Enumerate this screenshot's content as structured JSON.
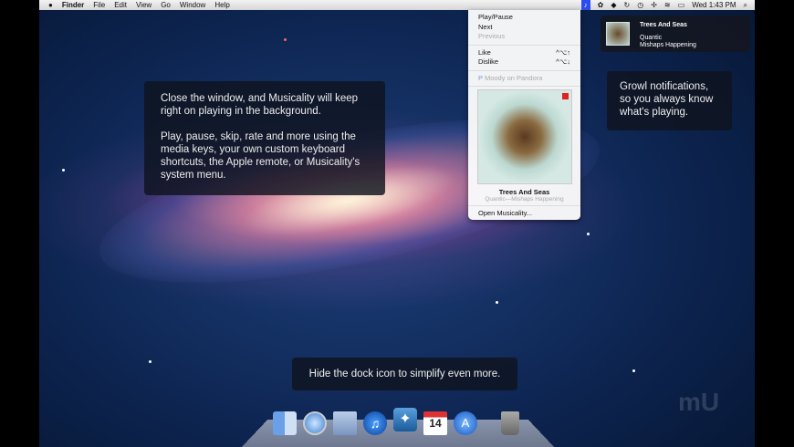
{
  "menubar": {
    "apple": "",
    "items": [
      "Finder",
      "File",
      "Edit",
      "View",
      "Go",
      "Window",
      "Help"
    ],
    "clock": "Wed 1:43 PM"
  },
  "menu": {
    "play": "Play/Pause",
    "next": "Next",
    "previous": "Previous",
    "like": "Like",
    "like_sc": "^⌥↑",
    "dislike": "Dislike",
    "dislike_sc": "^⌥↓",
    "station": "Moody on Pandora",
    "station_icon": "P",
    "track": "Trees And Seas",
    "sub": "Quantic—Mishaps Happening",
    "open": "Open Musicality..."
  },
  "growl": {
    "title": "Trees And Seas",
    "artist": "Quantic",
    "album": "Mishaps Happening"
  },
  "callouts": {
    "main_p1": "Close the window, and Musicality will keep right on playing in the background.",
    "main_p2": "Play, pause, skip, rate and more using the media keys, your own custom keyboard shortcuts, the Apple remote, or Musicality's system menu.",
    "growl": "Growl notifications, so you always know what's playing.",
    "dock": "Hide the dock icon to simplify even more."
  },
  "dock": {
    "calendar_day": "14"
  },
  "watermark": "mU"
}
